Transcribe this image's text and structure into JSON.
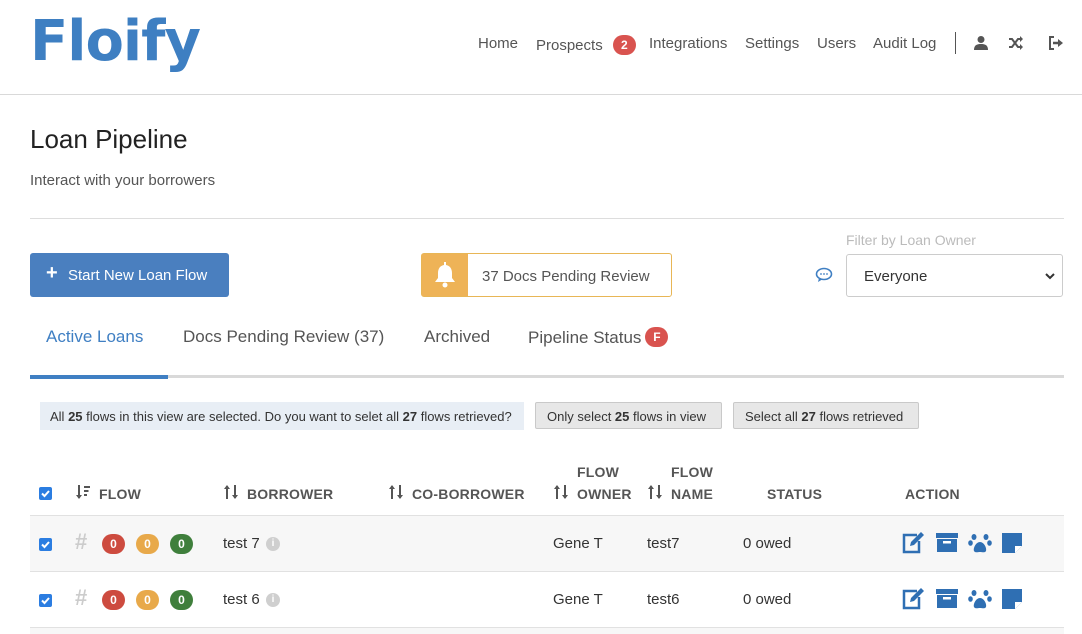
{
  "app": {
    "logo_text": "Floify"
  },
  "nav": {
    "items": [
      {
        "label": "Home"
      },
      {
        "label": "Prospects",
        "badge": "2"
      },
      {
        "label": "Integrations"
      },
      {
        "label": "Settings"
      },
      {
        "label": "Users"
      },
      {
        "label": "Audit Log"
      }
    ],
    "icons": [
      "user-icon",
      "shuffle-icon",
      "sign-out-icon"
    ]
  },
  "page": {
    "title": "Loan Pipeline",
    "subtitle": "Interact with your borrowers"
  },
  "toolbar": {
    "start_label": "Start New Loan Flow",
    "pending_label": "37 Docs Pending Review",
    "filter_label": "Filter by Loan Owner",
    "filter_value": "Everyone"
  },
  "tabs": [
    {
      "label": "Active Loans",
      "active": true
    },
    {
      "label": "Docs Pending Review (37)"
    },
    {
      "label": "Archived"
    },
    {
      "label": "Pipeline Status",
      "badge": "F"
    }
  ],
  "selection": {
    "banner_parts": [
      "All ",
      "25",
      " flows in this view are selected. Do you want to selet all ",
      "27",
      " flows retrieved?"
    ],
    "only_select_parts": [
      "Only select ",
      "25",
      " flows in view"
    ],
    "select_all_parts": [
      "Select all ",
      "27",
      " flows retrieved"
    ]
  },
  "table": {
    "columns": {
      "flow": "FLOW",
      "borrower": "BORROWER",
      "coborrower": "CO-BORROWER",
      "flow_owner_1": "FLOW",
      "flow_owner_2": "OWNER",
      "flow_name_1": "FLOW",
      "flow_name_2": "NAME",
      "status": "STATUS",
      "action": "ACTION"
    },
    "rows": [
      {
        "counts": [
          "0",
          "0",
          "0"
        ],
        "borrower": "test 7",
        "coborrower": "",
        "owner": "Gene T",
        "flow_name": "test7",
        "status": "0 owed",
        "checked": true
      },
      {
        "counts": [
          "0",
          "0",
          "0"
        ],
        "borrower": "test 6",
        "coborrower": "",
        "owner": "Gene T",
        "flow_name": "test6",
        "status": "0 owed",
        "checked": true
      }
    ],
    "action_icons": [
      "edit-icon",
      "archive-icon",
      "paw-icon",
      "note-icon"
    ]
  },
  "colors": {
    "brand": "#3e7fc2",
    "primary_button": "#4a7fbf",
    "warning": "#eeb357",
    "danger": "#d9534f",
    "success": "#3f7f3c",
    "count_red": "#cd4b3f",
    "count_orange": "#e8a94a",
    "count_green": "#3f7f3c"
  }
}
